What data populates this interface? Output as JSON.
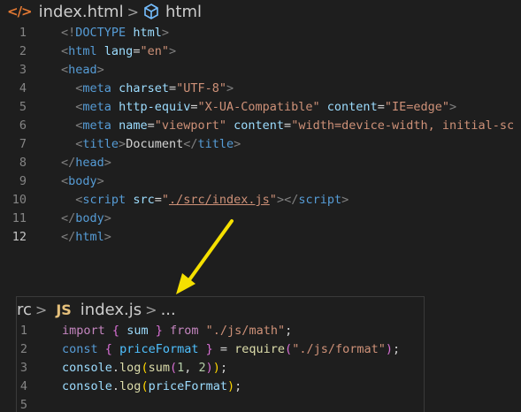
{
  "html_editor": {
    "breadcrumb": {
      "file_icon": "</>",
      "file": "index.html",
      "symbol": "html"
    },
    "lines": [
      {
        "num": "1",
        "tokens": [
          {
            "c": "t-tag",
            "t": "<!"
          },
          {
            "c": "t-name",
            "t": "DOCTYPE"
          },
          {
            "c": "t-text",
            "t": " "
          },
          {
            "c": "t-attr",
            "t": "html"
          },
          {
            "c": "t-tag",
            "t": ">"
          }
        ],
        "indent": 0
      },
      {
        "num": "2",
        "tokens": [
          {
            "c": "t-tag",
            "t": "<"
          },
          {
            "c": "t-name",
            "t": "html"
          },
          {
            "c": "t-text",
            "t": " "
          },
          {
            "c": "t-attr",
            "t": "lang"
          },
          {
            "c": "t-text",
            "t": "="
          },
          {
            "c": "t-str",
            "t": "\"en\""
          },
          {
            "c": "t-tag",
            "t": ">"
          }
        ],
        "indent": 0
      },
      {
        "num": "3",
        "tokens": [
          {
            "c": "t-tag",
            "t": "<"
          },
          {
            "c": "t-name",
            "t": "head"
          },
          {
            "c": "t-tag",
            "t": ">"
          }
        ],
        "indent": 0
      },
      {
        "num": "4",
        "tokens": [
          {
            "c": "t-tag",
            "t": "<"
          },
          {
            "c": "t-name",
            "t": "meta"
          },
          {
            "c": "t-text",
            "t": " "
          },
          {
            "c": "t-attr",
            "t": "charset"
          },
          {
            "c": "t-text",
            "t": "="
          },
          {
            "c": "t-str",
            "t": "\"UTF-8\""
          },
          {
            "c": "t-tag",
            "t": ">"
          }
        ],
        "indent": 1
      },
      {
        "num": "5",
        "tokens": [
          {
            "c": "t-tag",
            "t": "<"
          },
          {
            "c": "t-name",
            "t": "meta"
          },
          {
            "c": "t-text",
            "t": " "
          },
          {
            "c": "t-attr",
            "t": "http-equiv"
          },
          {
            "c": "t-text",
            "t": "="
          },
          {
            "c": "t-str",
            "t": "\"X-UA-Compatible\""
          },
          {
            "c": "t-text",
            "t": " "
          },
          {
            "c": "t-attr",
            "t": "content"
          },
          {
            "c": "t-text",
            "t": "="
          },
          {
            "c": "t-str",
            "t": "\"IE=edge\""
          },
          {
            "c": "t-tag",
            "t": ">"
          }
        ],
        "indent": 1
      },
      {
        "num": "6",
        "tokens": [
          {
            "c": "t-tag",
            "t": "<"
          },
          {
            "c": "t-name",
            "t": "meta"
          },
          {
            "c": "t-text",
            "t": " "
          },
          {
            "c": "t-attr",
            "t": "name"
          },
          {
            "c": "t-text",
            "t": "="
          },
          {
            "c": "t-str",
            "t": "\"viewport\""
          },
          {
            "c": "t-text",
            "t": " "
          },
          {
            "c": "t-attr",
            "t": "content"
          },
          {
            "c": "t-text",
            "t": "="
          },
          {
            "c": "t-str",
            "t": "\"width=device-width, initial-sc"
          }
        ],
        "indent": 1
      },
      {
        "num": "7",
        "tokens": [
          {
            "c": "t-tag",
            "t": "<"
          },
          {
            "c": "t-name",
            "t": "title"
          },
          {
            "c": "t-tag",
            "t": ">"
          },
          {
            "c": "t-text",
            "t": "Document"
          },
          {
            "c": "t-tag",
            "t": "</"
          },
          {
            "c": "t-name",
            "t": "title"
          },
          {
            "c": "t-tag",
            "t": ">"
          }
        ],
        "indent": 1
      },
      {
        "num": "8",
        "tokens": [
          {
            "c": "t-tag",
            "t": "</"
          },
          {
            "c": "t-name",
            "t": "head"
          },
          {
            "c": "t-tag",
            "t": ">"
          }
        ],
        "indent": 0
      },
      {
        "num": "9",
        "tokens": [
          {
            "c": "t-tag",
            "t": "<"
          },
          {
            "c": "t-name",
            "t": "body"
          },
          {
            "c": "t-tag",
            "t": ">"
          }
        ],
        "indent": 0
      },
      {
        "num": "10",
        "tokens": [
          {
            "c": "t-tag",
            "t": "<"
          },
          {
            "c": "t-name",
            "t": "script"
          },
          {
            "c": "t-text",
            "t": " "
          },
          {
            "c": "t-attr",
            "t": "src"
          },
          {
            "c": "t-text",
            "t": "="
          },
          {
            "c": "t-str",
            "t": "\""
          },
          {
            "c": "t-str t-link",
            "t": "./src/index.js"
          },
          {
            "c": "t-str",
            "t": "\""
          },
          {
            "c": "t-tag",
            "t": "></"
          },
          {
            "c": "t-name",
            "t": "script"
          },
          {
            "c": "t-tag",
            "t": ">"
          }
        ],
        "indent": 1
      },
      {
        "num": "11",
        "tokens": [
          {
            "c": "t-tag",
            "t": "</"
          },
          {
            "c": "t-name",
            "t": "body"
          },
          {
            "c": "t-tag",
            "t": ">"
          }
        ],
        "indent": 0
      },
      {
        "num": "12",
        "tokens": [
          {
            "c": "t-tag",
            "t": "</"
          },
          {
            "c": "t-name",
            "t": "html"
          },
          {
            "c": "t-tag",
            "t": ">"
          }
        ],
        "indent": 0,
        "active": true
      }
    ]
  },
  "js_editor": {
    "breadcrumb": {
      "prefix": "rc",
      "file_icon": "JS",
      "file": "index.js",
      "symbol": "..."
    },
    "lines": [
      {
        "num": "1",
        "tokens": [
          {
            "c": "k",
            "t": "import"
          },
          {
            "c": "p",
            "t": " "
          },
          {
            "c": "br1",
            "t": "{"
          },
          {
            "c": "p",
            "t": " "
          },
          {
            "c": "v",
            "t": "sum"
          },
          {
            "c": "p",
            "t": " "
          },
          {
            "c": "br1",
            "t": "}"
          },
          {
            "c": "p",
            "t": " "
          },
          {
            "c": "k",
            "t": "from"
          },
          {
            "c": "p",
            "t": " "
          },
          {
            "c": "s",
            "t": "\"./js/math\""
          },
          {
            "c": "p",
            "t": ";"
          }
        ]
      },
      {
        "num": "2",
        "tokens": [
          {
            "c": "kb",
            "t": "const"
          },
          {
            "c": "p",
            "t": " "
          },
          {
            "c": "br1",
            "t": "{"
          },
          {
            "c": "p",
            "t": " "
          },
          {
            "c": "c",
            "t": "priceFormat"
          },
          {
            "c": "p",
            "t": " "
          },
          {
            "c": "br1",
            "t": "}"
          },
          {
            "c": "p",
            "t": " = "
          },
          {
            "c": "f",
            "t": "require"
          },
          {
            "c": "br1",
            "t": "("
          },
          {
            "c": "s",
            "t": "\"./js/format\""
          },
          {
            "c": "br1",
            "t": ")"
          },
          {
            "c": "p",
            "t": ";"
          }
        ]
      },
      {
        "num": "3",
        "tokens": [
          {
            "c": "v",
            "t": "console"
          },
          {
            "c": "p",
            "t": "."
          },
          {
            "c": "f",
            "t": "log"
          },
          {
            "c": "br3",
            "t": "("
          },
          {
            "c": "f",
            "t": "sum"
          },
          {
            "c": "br1",
            "t": "("
          },
          {
            "c": "n",
            "t": "1"
          },
          {
            "c": "p",
            "t": ", "
          },
          {
            "c": "n",
            "t": "2"
          },
          {
            "c": "br1",
            "t": ")"
          },
          {
            "c": "br3",
            "t": ")"
          },
          {
            "c": "p",
            "t": ";"
          }
        ]
      },
      {
        "num": "4",
        "tokens": [
          {
            "c": "v",
            "t": "console"
          },
          {
            "c": "p",
            "t": "."
          },
          {
            "c": "f",
            "t": "log"
          },
          {
            "c": "br3",
            "t": "("
          },
          {
            "c": "v",
            "t": "priceFormat"
          },
          {
            "c": "br3",
            "t": ")"
          },
          {
            "c": "p",
            "t": ";"
          }
        ]
      },
      {
        "num": "5",
        "tokens": []
      }
    ]
  },
  "annotation": {
    "arrow_color": "#f5e000"
  }
}
